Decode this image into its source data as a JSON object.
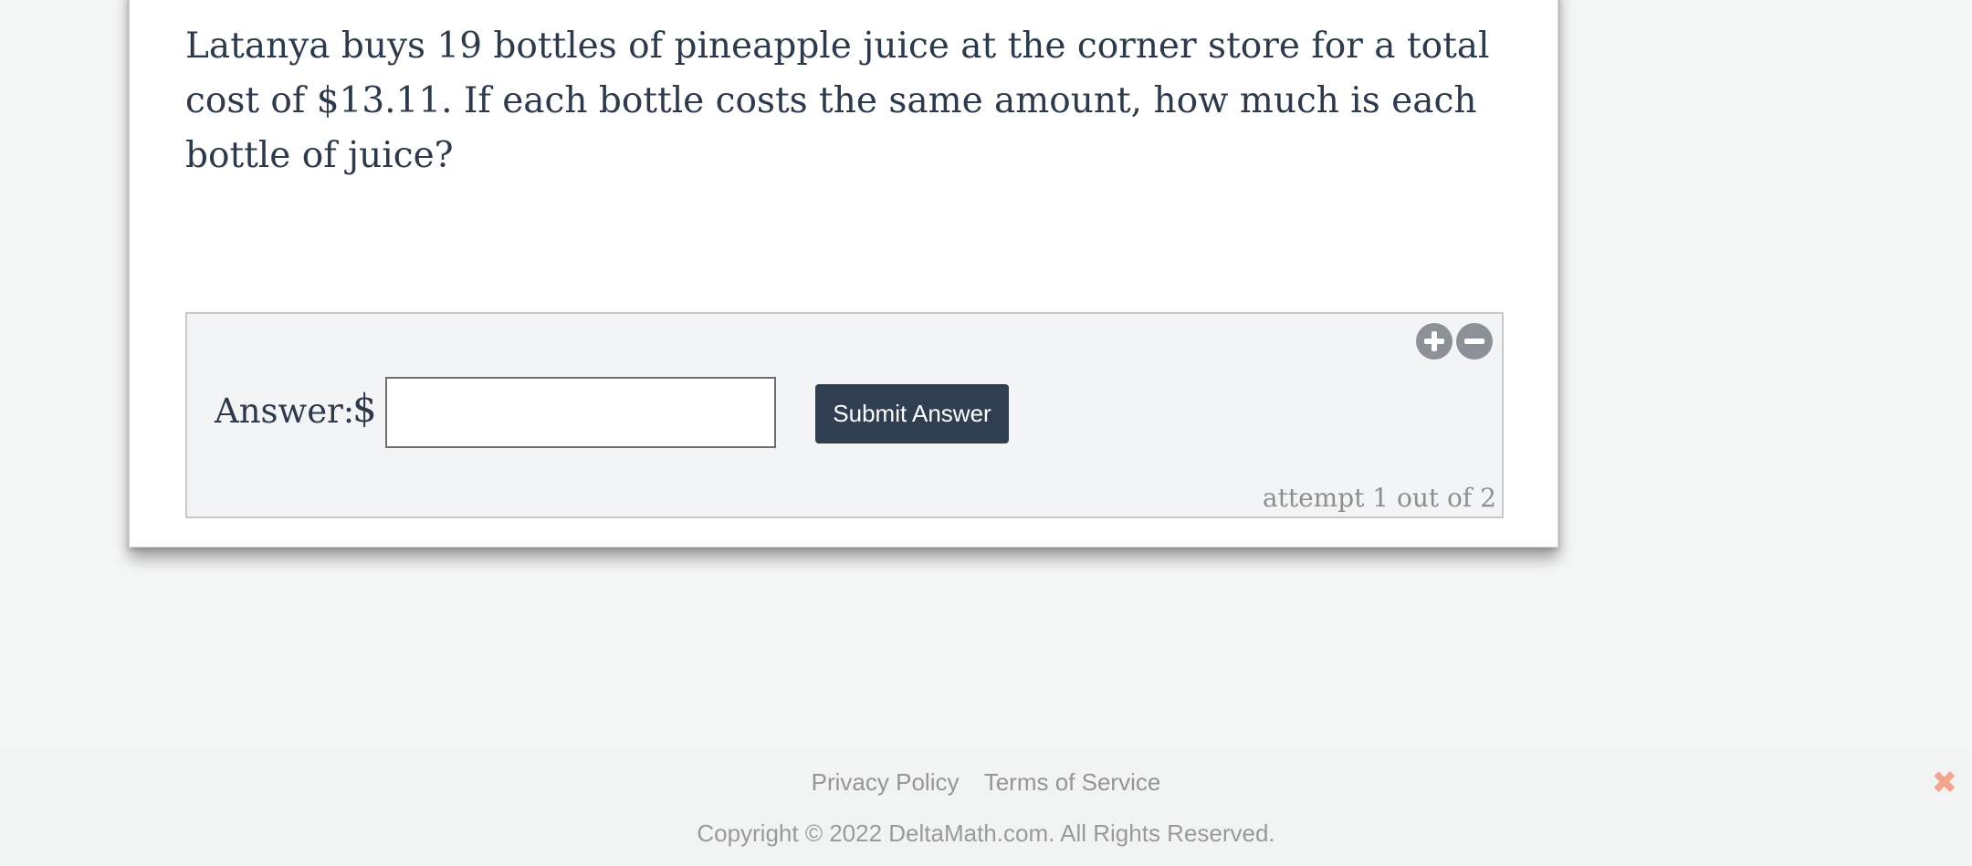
{
  "question": {
    "text": "Latanya buys 19 bottles of pineapple juice at the corner store for a total cost of $13.11. If each bottle costs the same amount, how much is each bottle of juice?"
  },
  "answer": {
    "label": "Answer:",
    "currency_symbol": "$",
    "input_value": "",
    "input_placeholder": "",
    "submit_label": "Submit Answer",
    "attempt_text": "attempt 1 out of 2"
  },
  "zoom_controls": {
    "zoom_in_icon": "plus-circle-icon",
    "zoom_out_icon": "minus-circle-icon"
  },
  "footer": {
    "privacy_label": "Privacy Policy",
    "terms_label": "Terms of Service",
    "copyright": "Copyright © 2022 DeltaMath.com. All Rights Reserved.",
    "close_glyph": "✖",
    "close_color": "#f0a58c"
  },
  "colors": {
    "button_bg": "#2f3e50",
    "text_primary": "#2c3a4b",
    "icon_gray": "#8c9097"
  }
}
